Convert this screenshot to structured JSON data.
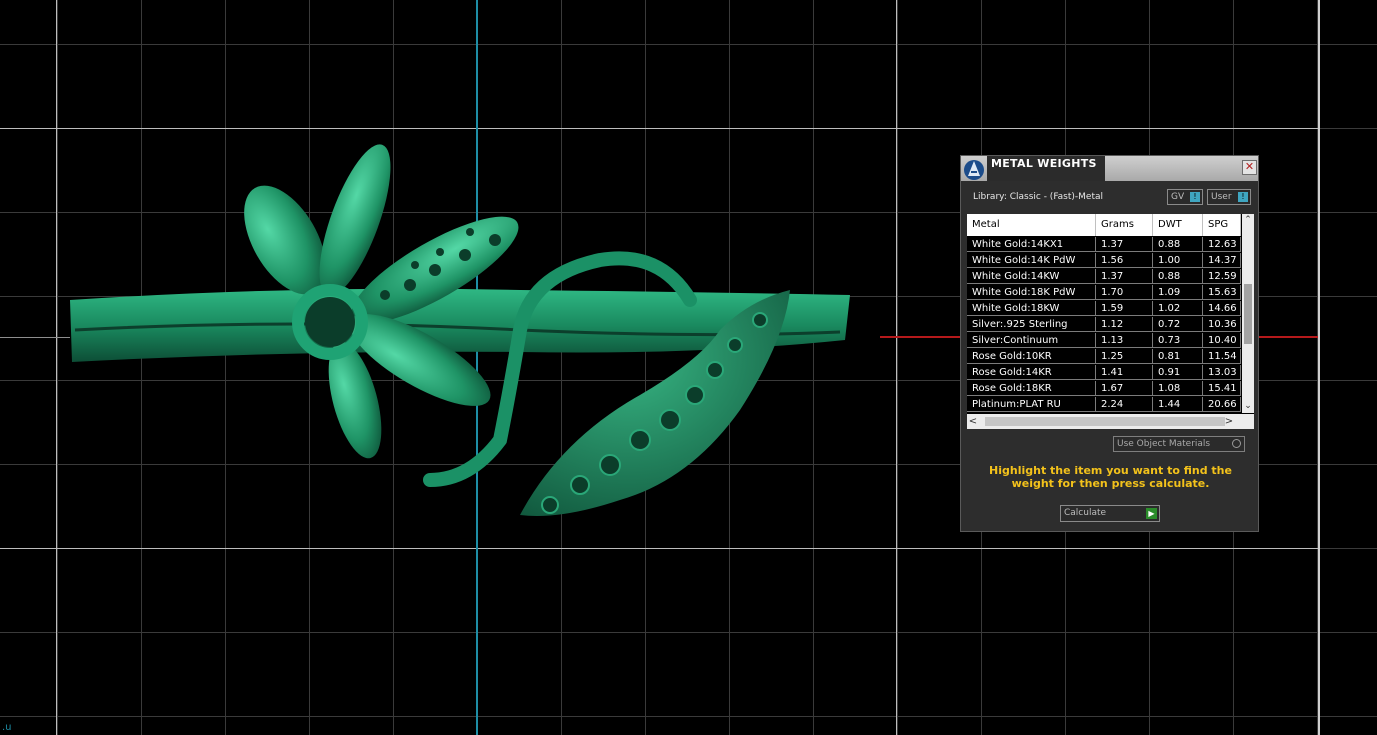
{
  "viewport": {
    "corner_label": ".u",
    "background_color": "#000000",
    "grid_color": "#3a3a3a",
    "axis_vertical_color": "#1e8ea6",
    "axis_horizontal_color": "#b5191b",
    "model_color": "#1f8a64"
  },
  "panel": {
    "title": "METAL WEIGHTS",
    "close_label": "✕",
    "library_label": "Library: Classic - (Fast)-Metal",
    "gv_select": "GV",
    "user_select": "User",
    "select_button": "!",
    "columns": [
      "Metal",
      "Grams",
      "DWT",
      "SPG"
    ],
    "rows": [
      {
        "metal": "White Gold:14KX1",
        "grams": "1.37",
        "dwt": "0.88",
        "spg": "12.63"
      },
      {
        "metal": "White Gold:14K PdW",
        "grams": "1.56",
        "dwt": "1.00",
        "spg": "14.37"
      },
      {
        "metal": "White Gold:14KW",
        "grams": "1.37",
        "dwt": "0.88",
        "spg": "12.59"
      },
      {
        "metal": "White Gold:18K PdW",
        "grams": "1.70",
        "dwt": "1.09",
        "spg": "15.63"
      },
      {
        "metal": "White Gold:18KW",
        "grams": "1.59",
        "dwt": "1.02",
        "spg": "14.66"
      },
      {
        "metal": "Silver:.925 Sterling",
        "grams": "1.12",
        "dwt": "0.72",
        "spg": "10.36"
      },
      {
        "metal": "Silver:Continuum",
        "grams": "1.13",
        "dwt": "0.73",
        "spg": "10.40"
      },
      {
        "metal": "Rose Gold:10KR",
        "grams": "1.25",
        "dwt": "0.81",
        "spg": "11.54"
      },
      {
        "metal": "Rose Gold:14KR",
        "grams": "1.41",
        "dwt": "0.91",
        "spg": "13.03"
      },
      {
        "metal": "Rose Gold:18KR",
        "grams": "1.67",
        "dwt": "1.08",
        "spg": "15.41"
      },
      {
        "metal": "Platinum:PLAT RU",
        "grams": "2.24",
        "dwt": "1.44",
        "spg": "20.66"
      }
    ],
    "scroll_up": "⌃",
    "scroll_down": "⌄",
    "scroll_left": "<",
    "scroll_right": ">",
    "use_object_materials": "Use Object Materials",
    "instruction": "Highlight the item you want to find the weight for then press calculate.",
    "calculate_label": "Calculate",
    "calculate_go": "▶",
    "accent_color": "#f3c21b"
  }
}
